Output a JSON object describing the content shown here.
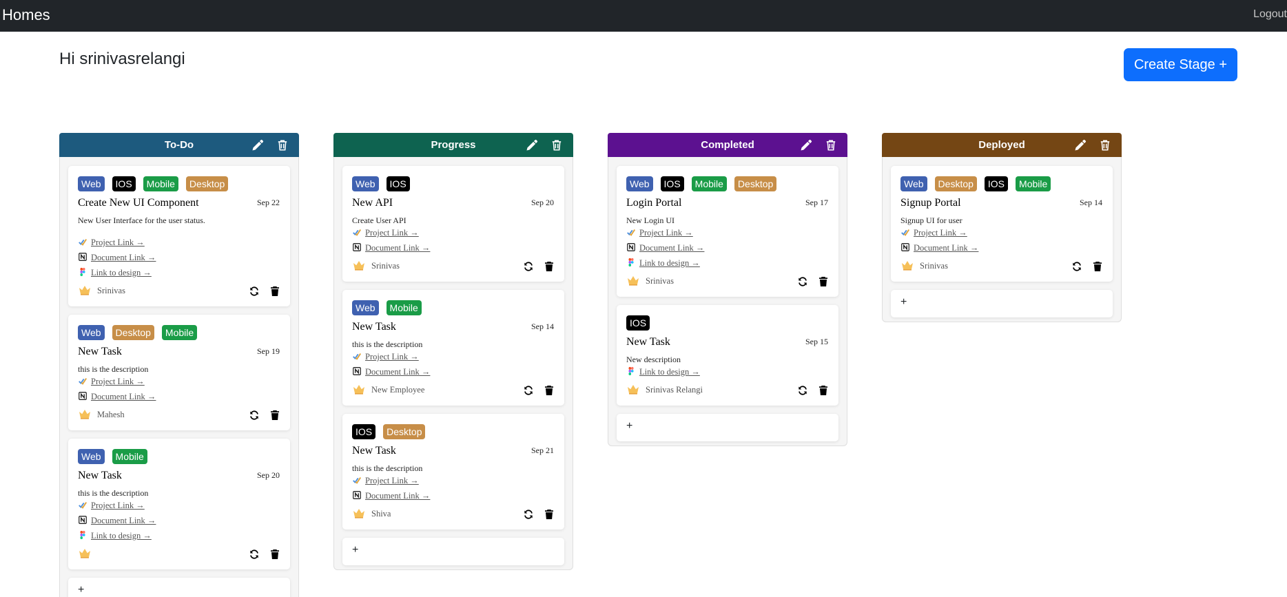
{
  "nav": {
    "brand": "Homes",
    "logout": "Logout"
  },
  "greeting": "Hi srinivasrelangi",
  "create_stage_label": "Create Stage +",
  "colors": {
    "Web": "#3f61b0",
    "IOS": "#000000",
    "Mobile": "#1a9c47",
    "Desktop": "#c78e48",
    "todo": "#1d5a7e",
    "progress": "#0e6350",
    "completed": "#5c1190",
    "deployed": "#744614",
    "primary": "#0d6efd",
    "navbar": "#212529"
  },
  "link_labels": {
    "project": "Project Link →",
    "document": "Document Link →",
    "design": "Link to design →"
  },
  "add_label": "+",
  "stages": [
    {
      "title": "To-Do",
      "color": "#1d5a7e",
      "tasks": [
        {
          "badges": [
            "Web",
            "IOS",
            "Mobile",
            "Desktop"
          ],
          "title": "Create New UI Component",
          "date": "Sep 22",
          "desc": "New User Interface for the user status.",
          "links": [
            "project",
            "document",
            "design"
          ],
          "assignee": "Srinivas"
        },
        {
          "badges": [
            "Web",
            "Desktop",
            "Mobile"
          ],
          "title": "New Task",
          "date": "Sep 19",
          "desc": "this is the description",
          "links": [
            "project",
            "document"
          ],
          "assignee": "Mahesh"
        },
        {
          "badges": [
            "Web",
            "Mobile"
          ],
          "title": "New Task",
          "date": "Sep 20",
          "desc": "this is the description",
          "links": [
            "project",
            "document",
            "design"
          ],
          "assignee": ""
        }
      ]
    },
    {
      "title": "Progress",
      "color": "#0e6350",
      "tasks": [
        {
          "badges": [
            "Web",
            "IOS"
          ],
          "title": "New API",
          "date": "Sep 20",
          "desc": "Create User API",
          "links": [
            "project",
            "document"
          ],
          "assignee": "Srinivas"
        },
        {
          "badges": [
            "Web",
            "Mobile"
          ],
          "title": "New Task",
          "date": "Sep 14",
          "desc": "this is the description",
          "links": [
            "project",
            "document"
          ],
          "assignee": "New Employee"
        },
        {
          "badges": [
            "IOS",
            "Desktop"
          ],
          "title": "New Task",
          "date": "Sep 21",
          "desc": "this is the description",
          "links": [
            "project",
            "document"
          ],
          "assignee": "Shiva"
        }
      ]
    },
    {
      "title": "Completed",
      "color": "#5c1190",
      "tasks": [
        {
          "badges": [
            "Web",
            "IOS",
            "Mobile",
            "Desktop"
          ],
          "title": "Login Portal",
          "date": "Sep 17",
          "desc": "New Login UI",
          "links": [
            "project",
            "document",
            "design"
          ],
          "assignee": "Srinivas"
        },
        {
          "badges": [
            "IOS"
          ],
          "title": "New Task",
          "date": "Sep 15",
          "desc": "New description",
          "links": [
            "design"
          ],
          "assignee": "Srinivas Relangi"
        }
      ]
    },
    {
      "title": "Deployed",
      "color": "#744614",
      "tasks": [
        {
          "badges": [
            "Web",
            "Desktop",
            "IOS",
            "Mobile"
          ],
          "title": "Signup Portal",
          "date": "Sep 14",
          "desc": "Signup UI for user",
          "links": [
            "project",
            "document"
          ],
          "assignee": "Srinivas"
        }
      ]
    }
  ]
}
